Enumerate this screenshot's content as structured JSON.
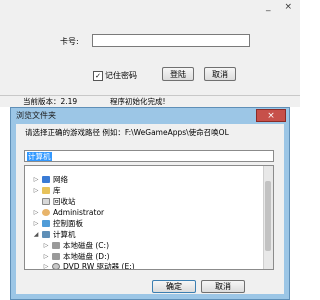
{
  "top_window": {
    "controls": [
      "_",
      "×"
    ],
    "card_label": "卡号:",
    "card_value": "",
    "remember_label": "记住密码",
    "remember_checked": true,
    "login_label": "登陆",
    "cancel_label": "取消"
  },
  "status": {
    "version": "当前版本：2.19",
    "message": "程序初始化完成!"
  },
  "dialog": {
    "title": "浏览文件夹",
    "close": "×",
    "instruction": "请选择正确的游戏路径 例如：F:\\WeGameApps\\使命召唤OL",
    "path_value": "计算机",
    "tree": [
      {
        "label": "网络",
        "icon": "network-icon",
        "arrow": "▷"
      },
      {
        "label": "库",
        "icon": "library-icon",
        "arrow": "▷"
      },
      {
        "label": "回收站",
        "icon": "recycle-bin-icon",
        "arrow": ""
      },
      {
        "label": "Administrator",
        "icon": "user-folder-icon",
        "arrow": "▷"
      },
      {
        "label": "控制面板",
        "icon": "control-panel-icon",
        "arrow": "▷"
      },
      {
        "label": "计算机",
        "icon": "computer-icon",
        "arrow": "◢"
      },
      {
        "label": "本地磁盘 (C:)",
        "icon": "disk-icon",
        "arrow": "▷"
      },
      {
        "label": "本地磁盘 (D:)",
        "icon": "disk-icon",
        "arrow": "▷"
      },
      {
        "label": "DVD RW 驱动器 (E:)",
        "icon": "dvd-icon",
        "arrow": "▷"
      }
    ],
    "ok_label": "确定",
    "cancel_label": "取消"
  }
}
